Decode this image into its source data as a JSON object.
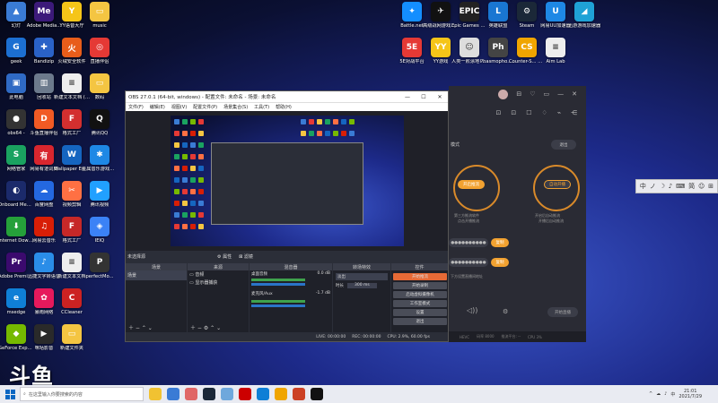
{
  "desktop_icons": [
    {
      "label": "幻灯",
      "color": "#3a7bd5",
      "glyph": "▲",
      "col": 0,
      "row": 0
    },
    {
      "label": "geek",
      "color": "#1c6fd1",
      "glyph": "G",
      "col": 0,
      "row": 1
    },
    {
      "label": "此电脑",
      "color": "#2f6ac4",
      "glyph": "▣",
      "col": 0,
      "row": 2
    },
    {
      "label": "obs64 -",
      "color": "#333333",
      "glyph": "●",
      "col": 0,
      "row": 3
    },
    {
      "label": "网络管家",
      "color": "#1aa260",
      "glyph": "S",
      "col": 0,
      "row": 4
    },
    {
      "label": "Onboard Memori...",
      "color": "#1b2a6b",
      "glyph": "◐",
      "col": 0,
      "row": 5
    },
    {
      "label": "Internet Downlo...",
      "color": "#25a03a",
      "glyph": "⬇",
      "col": 0,
      "row": 6
    },
    {
      "label": "Adobe Premiere ...",
      "color": "#3b0a6e",
      "glyph": "Pr",
      "col": 0,
      "row": 7
    },
    {
      "label": "msedge",
      "color": "#0f7fd6",
      "glyph": "e",
      "col": 0,
      "row": 8
    },
    {
      "label": "GeForce Experience",
      "color": "#76b900",
      "glyph": "◆",
      "col": 0,
      "row": 9
    },
    {
      "label": "Adobe Media...",
      "color": "#3c1a7a",
      "glyph": "Me",
      "col": 1,
      "row": 0
    },
    {
      "label": "Bandizip",
      "color": "#2a62c7",
      "glyph": "✚",
      "col": 1,
      "row": 1
    },
    {
      "label": "回收站",
      "color": "#6c7a8c",
      "glyph": "▥",
      "col": 1,
      "row": 2
    },
    {
      "label": "斗鱼直播伴侣",
      "color": "#f15a24",
      "glyph": "D",
      "col": 1,
      "row": 3
    },
    {
      "label": "网易有道词典",
      "color": "#d8262e",
      "glyph": "有",
      "col": 1,
      "row": 4
    },
    {
      "label": "百度网盘",
      "color": "#2468e0",
      "glyph": "☁",
      "col": 1,
      "row": 5
    },
    {
      "label": "网易云音乐",
      "color": "#d81e06",
      "glyph": "♫",
      "col": 1,
      "row": 6
    },
    {
      "label": "迅捷文字转语音",
      "color": "#2a8de8",
      "glyph": "♪",
      "col": 1,
      "row": 7
    },
    {
      "label": "暴雨网络",
      "color": "#e6195c",
      "glyph": "✿",
      "col": 1,
      "row": 8
    },
    {
      "label": "咪咕影音",
      "color": "#2a2a2a",
      "glyph": "▶",
      "col": 1,
      "row": 9
    },
    {
      "label": "YY语音大厅",
      "color": "#f5c518",
      "glyph": "Y",
      "col": 2,
      "row": 0
    },
    {
      "label": "火绒安全软件",
      "color": "#e85d1a",
      "glyph": "火",
      "col": 2,
      "row": 1
    },
    {
      "label": "新建文本文档 (2)",
      "color": "#eeeeee",
      "glyph": "≡",
      "col": 2,
      "row": 2
    },
    {
      "label": "格式工厂",
      "color": "#d32f2f",
      "glyph": "F",
      "col": 2,
      "row": 3
    },
    {
      "label": "Wallpaper Engine:...",
      "color": "#1565c0",
      "glyph": "W",
      "col": 2,
      "row": 4
    },
    {
      "label": "视频剪辑",
      "color": "#ff7043",
      "glyph": "✂",
      "col": 2,
      "row": 5
    },
    {
      "label": "格式工厂",
      "color": "#c62828",
      "glyph": "F",
      "col": 2,
      "row": 6
    },
    {
      "label": "新建文本文档",
      "color": "#eeeeee",
      "glyph": "≡",
      "col": 2,
      "row": 7
    },
    {
      "label": "CCleaner",
      "color": "#cc2222",
      "glyph": "C",
      "col": 2,
      "row": 8
    },
    {
      "label": "新建文件夹",
      "color": "#f4c542",
      "glyph": "▭",
      "col": 2,
      "row": 9
    },
    {
      "label": "music",
      "color": "#f4c542",
      "glyph": "▭",
      "col": 3,
      "row": 0
    },
    {
      "label": "直播伴侣",
      "color": "#e53935",
      "glyph": "◎",
      "col": 3,
      "row": 1
    },
    {
      "label": "数码",
      "color": "#f4c542",
      "glyph": "▭",
      "col": 3,
      "row": 2
    },
    {
      "label": "腾讯QQ",
      "color": "#111111",
      "glyph": "Q",
      "col": 3,
      "row": 3
    },
    {
      "label": "金属音乐游戏社区",
      "color": "#1e88e5",
      "glyph": "✱",
      "col": 3,
      "row": 4
    },
    {
      "label": "腾讯视频",
      "color": "#21a0ff",
      "glyph": "▶",
      "col": 3,
      "row": 5
    },
    {
      "label": "IEIQ",
      "color": "#3b82f6",
      "glyph": "◈",
      "col": 3,
      "row": 6
    },
    {
      "label": "perfectMo...",
      "color": "#333333",
      "glyph": "P",
      "col": 3,
      "row": 7
    }
  ],
  "desktop_icons_right": [
    {
      "label": "Battle.net",
      "color": "#148eff",
      "glyph": "✦",
      "col": 0,
      "row": 0
    },
    {
      "label": "5E对战平台",
      "color": "#e53935",
      "glyph": "5E",
      "col": 0,
      "row": 1
    },
    {
      "label": "高级战网游戏平台",
      "color": "#111111",
      "glyph": "✈",
      "col": 1,
      "row": 0
    },
    {
      "label": "YY游戏",
      "color": "#f5c518",
      "glyph": "YY",
      "col": 1,
      "row": 1
    },
    {
      "label": "Epic Games Launcher",
      "color": "#222222",
      "glyph": "EPIC",
      "col": 2,
      "row": 0
    },
    {
      "label": "人类一败涂地 Human Fa...",
      "color": "#dddddd",
      "glyph": "☺",
      "col": 2,
      "row": 1
    },
    {
      "label": "英雄联盟",
      "color": "#1976d2",
      "glyph": "L",
      "col": 3,
      "row": 0
    },
    {
      "label": "Phasmopho... - 快捷方式",
      "color": "#444444",
      "glyph": "Ph",
      "col": 3,
      "row": 1
    },
    {
      "label": "Steam",
      "color": "#1b2838",
      "glyph": "⚙",
      "col": 4,
      "row": 0
    },
    {
      "label": "Counter-S... Global Off...",
      "color": "#f0a500",
      "glyph": "CS",
      "col": 4,
      "row": 1
    },
    {
      "label": "网易UU加速器",
      "color": "#1e88e5",
      "glyph": "U",
      "col": 5,
      "row": 0
    },
    {
      "label": "Aim Lab",
      "color": "#eeeeee",
      "glyph": "≡",
      "col": 5,
      "row": 1
    },
    {
      "label": "迅游游戏加速器",
      "color": "#1fa2d6",
      "glyph": "◢",
      "col": 6,
      "row": 0
    }
  ],
  "obs": {
    "title": "OBS 27.0.1 (64-bit, windows) - 配置文件: 未命名 - 场景: 未命名",
    "window_buttons": [
      "—",
      "☐",
      "✕"
    ],
    "menu": [
      "文件(F)",
      "编辑(E)",
      "视图(V)",
      "配置文件(P)",
      "场景集合(S)",
      "工具(T)",
      "帮助(H)"
    ],
    "scene_status": "未选择源",
    "source_toolbar": [
      "⚙ 属性",
      "⊠ 滤镜"
    ],
    "dock_titles": [
      "场景",
      "来源",
      "混音器",
      "转场特效",
      "控件"
    ],
    "scenes": [
      "场景"
    ],
    "sources": [
      "音频",
      "显示器捕获"
    ],
    "mixer": [
      {
        "name": "桌面音频",
        "db": "0.0 dB"
      },
      {
        "name": "麦克风/Aux",
        "db": "-1.7 dB"
      }
    ],
    "transition": {
      "type": "淡出",
      "duration_label": "时长",
      "duration": "300 ms"
    },
    "controls": [
      "开始推流",
      "开始录制",
      "启动虚拟摄像机",
      "工作室模式",
      "设置",
      "退出"
    ],
    "status": [
      "LIVE: 00:00:00",
      "REC: 00:00:00",
      "CPU: 2.9%, 60.00 fps"
    ]
  },
  "app": {
    "toolbar_icons": [
      "⊟",
      "♡",
      "▭",
      "—",
      "✕"
    ],
    "tab_icons": [
      "⊡",
      "⊡",
      "☐",
      "♢",
      "⌁",
      "⋲"
    ],
    "section_label": "模式",
    "exit_button": "退出",
    "circle_left": {
      "button": "开启推流",
      "line1": "第三方推流软件",
      "line2": "点击开播推流"
    },
    "circle_right": {
      "button": "自动开播",
      "line1": "开启后自动推流",
      "line2": "开播后自动推流"
    },
    "key_field": "●●●●●●●●●●",
    "copy_label": "复制",
    "server_field": "●●●●●●●●●●",
    "copy_label2": "复制",
    "hint": "下方设置直播间地址",
    "bottom_labels": [
      "HEVC",
      "码率 8000",
      "推流平台: --",
      "CPU 3%",
      "内存 54%",
      "GPU 1%"
    ],
    "start_button": "开始直播"
  },
  "ime": {
    "items": [
      "中",
      "ノ",
      "☽",
      "♪",
      "⌨",
      "简",
      "☺",
      "⊞"
    ]
  },
  "taskbar": {
    "search_placeholder": "在这里输入你要搜索的内容",
    "apps": [
      "#f1c232",
      "#3a7bd5",
      "#e06666",
      "#1b2838",
      "#6fa8dc",
      "#cc0000",
      "#0f7fd6",
      "#f0a500",
      "#cc4125",
      "#111111"
    ],
    "tray_icons": [
      "^",
      "⌃",
      "☁",
      "♪",
      "中"
    ],
    "time": "21:01",
    "date": "2021/7/29"
  },
  "watermark": "斗鱼"
}
